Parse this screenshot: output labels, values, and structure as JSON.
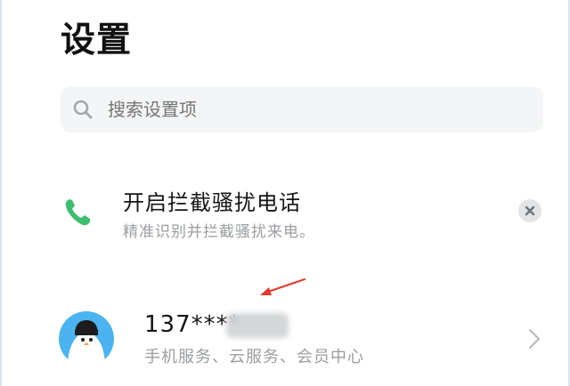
{
  "header": {
    "title": "设置"
  },
  "search": {
    "placeholder": "搜索设置项",
    "icon": "search-icon"
  },
  "suggestion": {
    "icon": "phone-icon",
    "title": "开启拦截骚扰电话",
    "subtitle": "精准识别并拦截骚扰来电。",
    "close_icon": "close-icon",
    "accent_color": "#3dbd6e"
  },
  "account": {
    "avatar": "penguin-avatar",
    "number": "137****",
    "subtitle": "手机服务、云服务、会员中心",
    "chevron_icon": "chevron-right-icon",
    "avatar_color": "#4bb4f0"
  },
  "annotation": {
    "arrow_color": "#e23a2e"
  }
}
